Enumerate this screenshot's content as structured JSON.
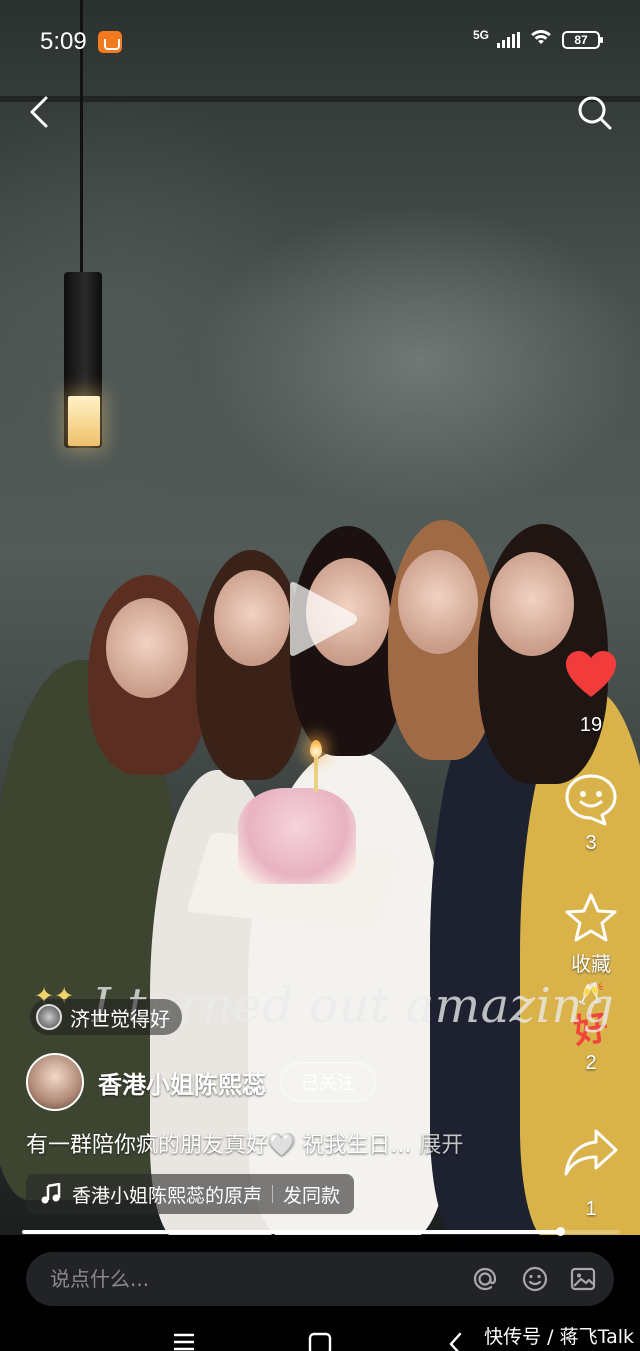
{
  "status_bar": {
    "time": "5:09",
    "app_icon": "taobao-icon",
    "network": "5G",
    "battery": "87"
  },
  "top_nav": {
    "back_icon": "chevron-left-icon",
    "search_icon": "search-icon"
  },
  "video": {
    "overlay_caption": "I turned out amazing",
    "play_icon": "play-icon",
    "progress": 0.9
  },
  "poi": {
    "label": "济世觉得好"
  },
  "author": {
    "name": "香港小姐陈熙蕊",
    "follow_label": "已关注"
  },
  "description": {
    "text": "有一群陪你疯的朋友真好🤍 祝我生日...",
    "expand_label": "展开"
  },
  "music": {
    "title": "香港小姐陈熙蕊的原声",
    "action_label": "发同款"
  },
  "actions": {
    "like_count": "19",
    "comment_count": "3",
    "favorite_label": "收藏",
    "good_label": "好",
    "good_count": "2",
    "share_count": "1"
  },
  "comment_bar": {
    "placeholder": "说点什么..."
  },
  "watermark": "快传号 / 蒋飞Talk",
  "colors": {
    "like_red": "#f23b3b",
    "good_red": "#f0453a",
    "comment_bg": "#222326"
  }
}
